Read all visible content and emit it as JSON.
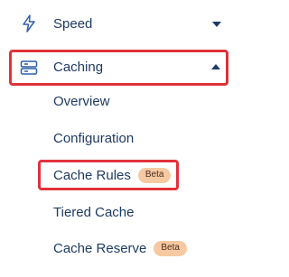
{
  "nav": {
    "speed": {
      "label": "Speed",
      "icon": "bolt-icon",
      "caret": "caret-down-icon"
    },
    "caching": {
      "label": "Caching",
      "icon": "server-stack-icon",
      "caret": "caret-up-icon",
      "items": [
        {
          "label": "Overview"
        },
        {
          "label": "Configuration"
        },
        {
          "label": "Cache Rules",
          "badge": "Beta"
        },
        {
          "label": "Tiered Cache"
        },
        {
          "label": "Cache Reserve",
          "badge": "Beta"
        }
      ]
    }
  },
  "colors": {
    "text": "#1f3b63",
    "icon": "#2f5fa8",
    "highlight_border": "#e0323b",
    "badge_bg": "#f6c9a2"
  }
}
